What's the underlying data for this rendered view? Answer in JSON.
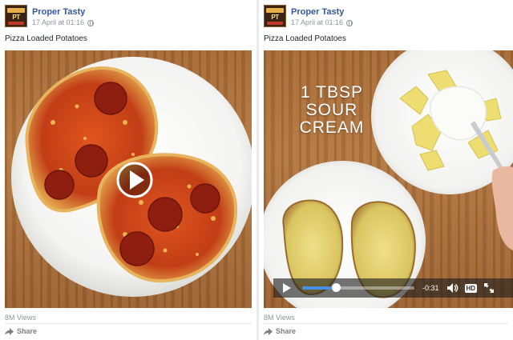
{
  "posts": [
    {
      "page_name": "Proper Tasty",
      "avatar_text": "PROPER TASTY",
      "timestamp": "17 April at 01:16",
      "privacy_icon": "globe-icon",
      "text": "Pizza Loaded Potatoes",
      "views": "8M Views",
      "share_label": "Share",
      "media": {
        "type": "video-thumbnail",
        "play_icon": "play-circle-icon"
      }
    },
    {
      "page_name": "Proper Tasty",
      "avatar_text": "PROPER TASTY",
      "timestamp": "17 April at 01:16",
      "privacy_icon": "globe-icon",
      "text": "Pizza Loaded Potatoes",
      "views": "8M Views",
      "share_label": "Share",
      "media": {
        "type": "video-playing",
        "caption_lines": [
          "1 TBSP",
          "SOUR",
          "CREAM"
        ],
        "controls": {
          "progress": 0.3,
          "time_remaining": "-0:31",
          "hd_label": "HD",
          "icons": [
            "play-icon",
            "volume-icon",
            "hd-icon",
            "fullscreen-icon"
          ]
        }
      }
    }
  ],
  "colors": {
    "page_name": "#365899",
    "meta": "#90949c",
    "background": "#e9ebee",
    "progress": "#4a90e2"
  }
}
